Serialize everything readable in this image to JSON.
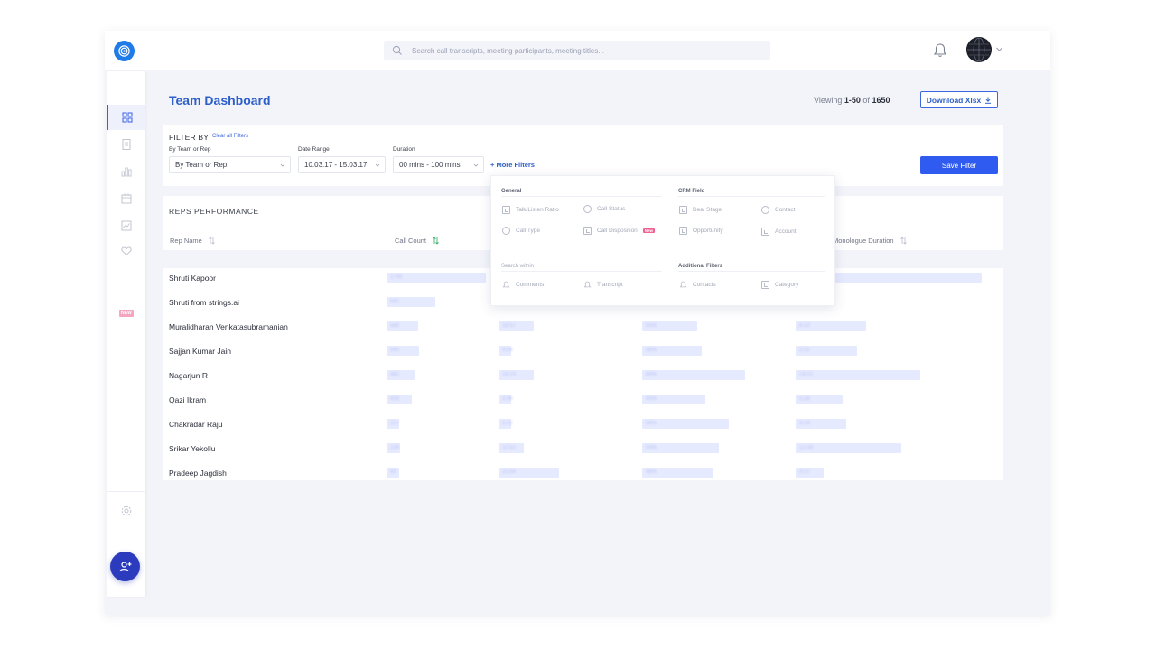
{
  "search": {
    "placeholder": "Search call transcripts, meeting participants, meeting titles..."
  },
  "header": {
    "title": "Team Dashboard",
    "viewing_prefix": "Viewing",
    "viewing_range": "1-50",
    "viewing_of": "of",
    "viewing_total": "1650",
    "download_label": "Download Xlsx"
  },
  "filters": {
    "title": "FILTER BY",
    "clear_label": "Clear all Filters",
    "team_label": "By Team or Rep",
    "team_value": "By Team or Rep",
    "date_label": "Date Range",
    "date_value": "10.03.17 - 15.03.17",
    "duration_label": "Duration",
    "duration_value": "00 mins - 100 mins",
    "more_label": "+ More Filters",
    "save_label": "Save Filter"
  },
  "sidebar": {
    "new_badge": "NEW"
  },
  "perf": {
    "title": "REPS PERFORMANCE",
    "col_rep": "Rep Name",
    "col_calls": "Call Count",
    "col_mono": "Monologue Duration"
  },
  "rows": [
    {
      "name": "Shruti Kapoor",
      "c1": "1756",
      "c2": "",
      "c3": "",
      "c4": ""
    },
    {
      "name": "Shruti from strings.ai",
      "c1": "561",
      "c2": "",
      "c3": "",
      "c4": ""
    },
    {
      "name": "Muralidharan Venkatasubramanian",
      "c1": "589",
      "c2": "18:57",
      "c3": "55%",
      "c4": "8:10"
    },
    {
      "name": "Sajjan Kumar Jain",
      "c1": "540",
      "c2": "4:54",
      "c3": "38%",
      "c4": "2:01"
    },
    {
      "name": "Nagarjun R",
      "c1": "482",
      "c2": "19:23",
      "c3": "84%",
      "c4": "14:21"
    },
    {
      "name": "Qazi Ikram",
      "c1": "439",
      "c2": "3:36",
      "c3": "40%",
      "c4": "5:28"
    },
    {
      "name": "Chakradar Raju",
      "c1": "217",
      "c2": "5:31",
      "c3": "56%",
      "c4": "3:14"
    },
    {
      "name": "Srikar Yekollu",
      "c1": "226",
      "c2": "12:51",
      "c3": "50%",
      "c4": "12:16"
    },
    {
      "name": "Pradeep Jagdish",
      "c1": "93",
      "c2": "22:54",
      "c3": "48%",
      "c4": "3:27"
    }
  ],
  "bar_fractions": [
    [
      1.0,
      0,
      0,
      1.0
    ],
    [
      0.49,
      0,
      0,
      0
    ],
    [
      0.32,
      0.43,
      0.52,
      0.38
    ],
    [
      0.33,
      0.16,
      0.56,
      0.33
    ],
    [
      0.28,
      0.43,
      0.97,
      0.67
    ],
    [
      0.25,
      0.15,
      0.59,
      0.25
    ],
    [
      0.13,
      0.15,
      0.81,
      0.27
    ],
    [
      0.14,
      0.31,
      0.72,
      0.57
    ],
    [
      0.11,
      0.74,
      0.67,
      0.15
    ]
  ],
  "more_filters": {
    "general_label": "General",
    "crm_label": "CRM Field",
    "general": [
      "Talk/Listen Ratio",
      "Call Status",
      "Call Type",
      "Call Disposition"
    ],
    "new_badge": "New",
    "crm": [
      "Deal Stage",
      "Contact",
      "Opportunity",
      "Account"
    ],
    "search_within_label": "Search within",
    "search_within": [
      "Comments",
      "Transcript"
    ],
    "additional_label": "Additional Filters",
    "additional": [
      "Contacts",
      "Category"
    ]
  }
}
